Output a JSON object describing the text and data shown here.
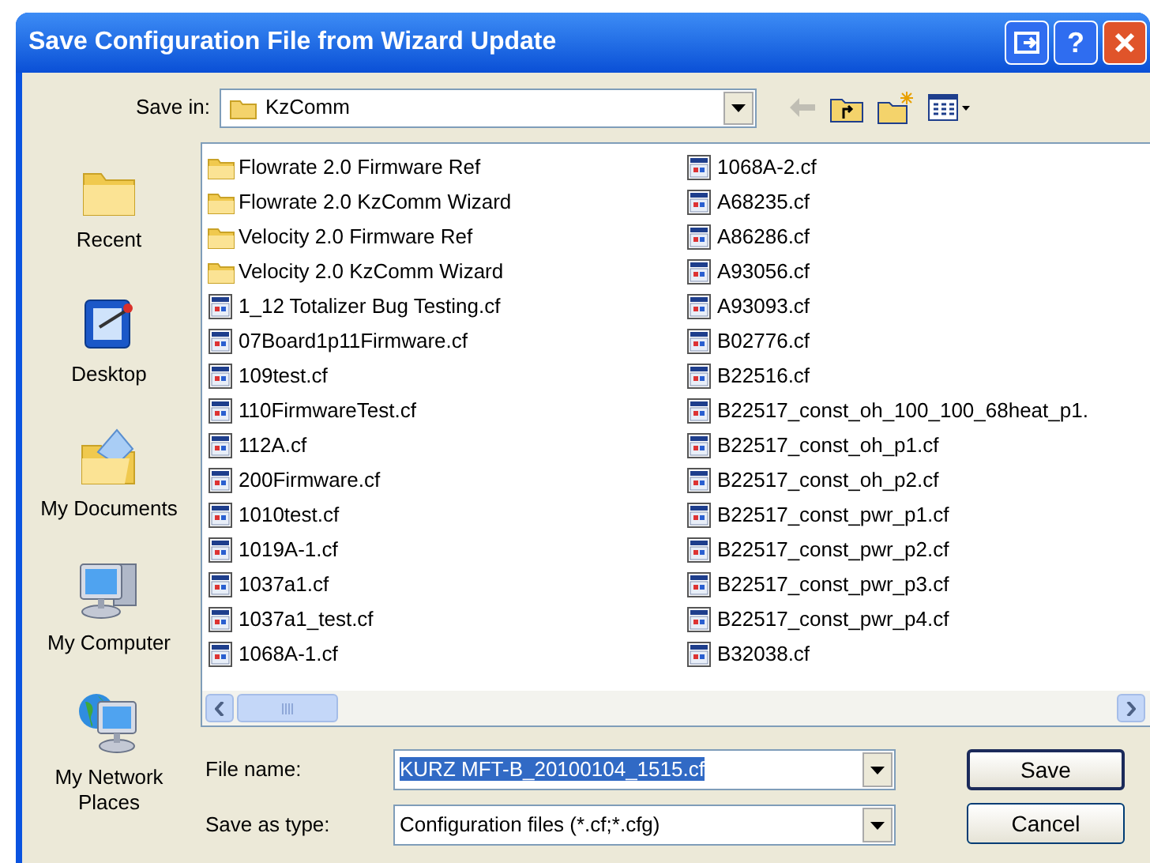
{
  "window": {
    "title": "Save Configuration File from Wizard Update",
    "help_button": "?"
  },
  "save_in": {
    "label": "Save in:",
    "value": "KzComm"
  },
  "toolbar": [
    {
      "kind": "back",
      "disabled": true
    },
    {
      "kind": "up",
      "disabled": false
    },
    {
      "kind": "new_folder",
      "disabled": false
    },
    {
      "kind": "views",
      "disabled": false
    }
  ],
  "places": [
    {
      "kind": "recent",
      "label": "Recent"
    },
    {
      "kind": "desktop",
      "label": "Desktop"
    },
    {
      "kind": "documents",
      "label": "My Documents"
    },
    {
      "kind": "computer",
      "label": "My Computer"
    },
    {
      "kind": "network",
      "label": "My Network Places"
    }
  ],
  "files": [
    {
      "kind": "folder",
      "name": "Flowrate 2.0 Firmware Ref"
    },
    {
      "kind": "folder",
      "name": "Flowrate 2.0 KzComm Wizard"
    },
    {
      "kind": "folder",
      "name": "Velocity 2.0 Firmware Ref"
    },
    {
      "kind": "folder",
      "name": "Velocity 2.0 KzComm Wizard"
    },
    {
      "kind": "file",
      "name": "1_12 Totalizer Bug Testing.cf"
    },
    {
      "kind": "file",
      "name": "07Board1p11Firmware.cf"
    },
    {
      "kind": "file",
      "name": "109test.cf"
    },
    {
      "kind": "file",
      "name": "110FirmwareTest.cf"
    },
    {
      "kind": "file",
      "name": "112A.cf"
    },
    {
      "kind": "file",
      "name": "200Firmware.cf"
    },
    {
      "kind": "file",
      "name": "1010test.cf"
    },
    {
      "kind": "file",
      "name": "1019A-1.cf"
    },
    {
      "kind": "file",
      "name": "1037a1.cf"
    },
    {
      "kind": "file",
      "name": "1037a1_test.cf"
    },
    {
      "kind": "file",
      "name": "1068A-1.cf"
    },
    {
      "kind": "file",
      "name": "1068A-2.cf"
    },
    {
      "kind": "file",
      "name": "A68235.cf"
    },
    {
      "kind": "file",
      "name": "A86286.cf"
    },
    {
      "kind": "file",
      "name": "A93056.cf"
    },
    {
      "kind": "file",
      "name": "A93093.cf"
    },
    {
      "kind": "file",
      "name": "B02776.cf"
    },
    {
      "kind": "file",
      "name": "B22516.cf"
    },
    {
      "kind": "file",
      "name": "B22517_const_oh_100_100_68heat_p1."
    },
    {
      "kind": "file",
      "name": "B22517_const_oh_p1.cf"
    },
    {
      "kind": "file",
      "name": "B22517_const_oh_p2.cf"
    },
    {
      "kind": "file",
      "name": "B22517_const_pwr_p1.cf"
    },
    {
      "kind": "file",
      "name": "B22517_const_pwr_p2.cf"
    },
    {
      "kind": "file",
      "name": "B22517_const_pwr_p3.cf"
    },
    {
      "kind": "file",
      "name": "B22517_const_pwr_p4.cf"
    },
    {
      "kind": "file",
      "name": "B32038.cf"
    }
  ],
  "file_name": {
    "label": "File name:",
    "value": "KURZ MFT-B_20100104_1515.cf",
    "text_selected": true
  },
  "save_as_type": {
    "label": "Save as type:",
    "value": "Configuration files (*.cf;*.cfg)"
  },
  "buttons": [
    {
      "label": "Save",
      "default": true
    },
    {
      "label": "Cancel",
      "default": false
    }
  ]
}
